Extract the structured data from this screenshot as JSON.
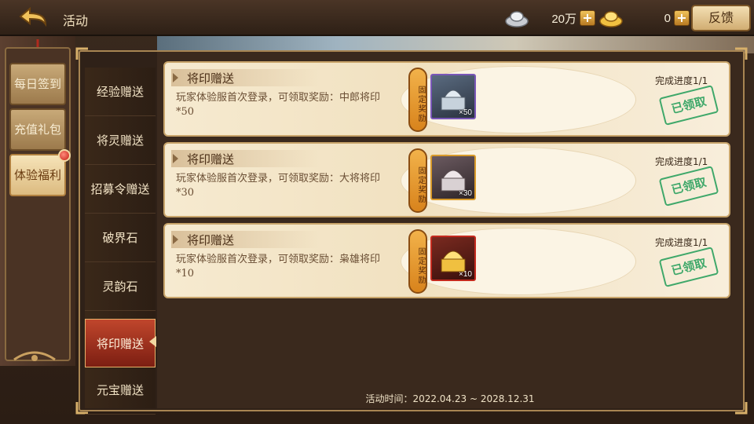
{
  "header": {
    "title": "活动",
    "silver": "20万",
    "gold": "0",
    "feedback_label": "反馈"
  },
  "left_menu": {
    "items": [
      {
        "label": "每日签到"
      },
      {
        "label": "充值礼包"
      },
      {
        "label": "体验福利",
        "active": true
      }
    ]
  },
  "tabs": [
    {
      "label": "经验赠送"
    },
    {
      "label": "将灵赠送"
    },
    {
      "label": "招募令赠送"
    },
    {
      "label": "破界石"
    },
    {
      "label": "灵韵石"
    },
    {
      "label": "将印赠送",
      "active": true
    },
    {
      "label": "元宝赠送"
    }
  ],
  "cards": [
    {
      "title": "将印赠送",
      "desc": "玩家体验服首次登录，可领取奖励：中郎将印*50",
      "fixed_label": "固定奖励",
      "item_qty": "×50",
      "item_icon": "silver-seal-icon",
      "item_border": "#7a57b8",
      "progress": "完成进度1/1",
      "status": "已领取"
    },
    {
      "title": "将印赠送",
      "desc": "玩家体验服首次登录，可领取奖励：大将将印*30",
      "fixed_label": "固定奖励",
      "item_qty": "×30",
      "item_icon": "stone-seal-icon",
      "item_border": "#d89a2a",
      "progress": "完成进度1/1",
      "status": "已领取"
    },
    {
      "title": "将印赠送",
      "desc": "玩家体验服首次登录，可领取奖励：枭雄将印*10",
      "fixed_label": "固定奖励",
      "item_qty": "×10",
      "item_icon": "gold-seal-icon",
      "item_border": "#c42a1e",
      "progress": "完成进度1/1",
      "status": "已领取"
    }
  ],
  "activity_time": "活动时间：2022.04.23 ~ 2028.12.31"
}
